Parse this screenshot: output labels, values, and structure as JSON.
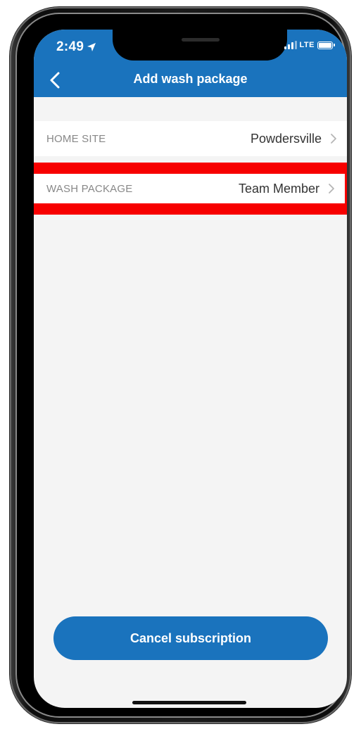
{
  "status_bar": {
    "time": "2:49",
    "network": "LTE"
  },
  "header": {
    "title": "Add wash package"
  },
  "settings": {
    "home_site": {
      "label": "HOME SITE",
      "value": "Powdersville"
    },
    "wash_package": {
      "label": "WASH PACKAGE",
      "value": "Team Member"
    }
  },
  "actions": {
    "cancel_label": "Cancel subscription"
  },
  "colors": {
    "brand_blue": "#1a73bd",
    "highlight_red": "#f70000",
    "background": "#f4f4f4"
  },
  "icons": [
    "location-arrow-icon",
    "signal-icon",
    "battery-icon",
    "back-chevron-icon",
    "chevron-right-icon"
  ]
}
